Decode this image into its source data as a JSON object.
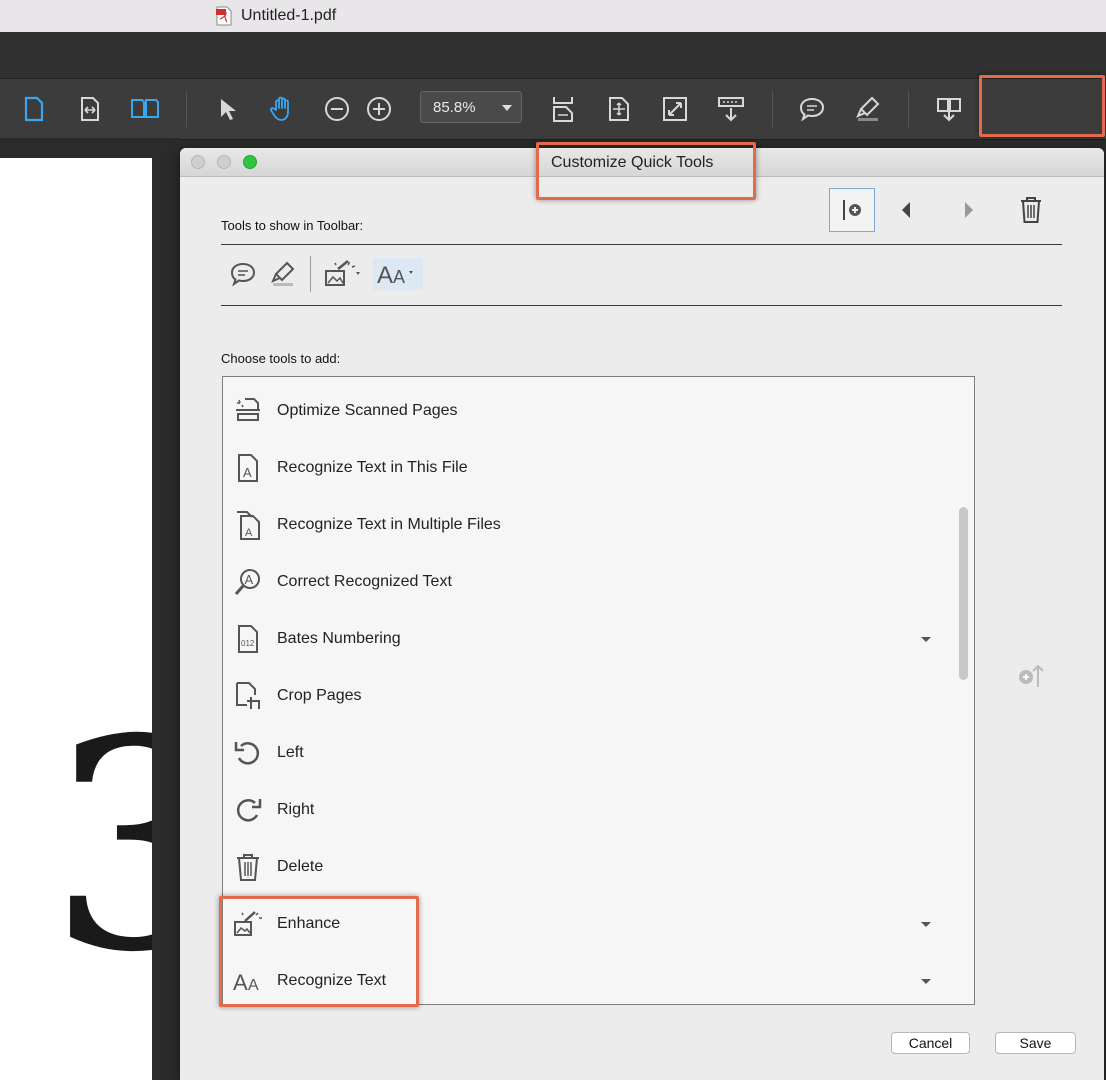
{
  "window": {
    "title": "Untitled-1.pdf"
  },
  "toolbar": {
    "zoom_value": "85.8%",
    "icons": [
      "single-page-icon",
      "fit-width-icon",
      "two-page-icon",
      "select-arrow-icon",
      "hand-icon",
      "zoom-out-icon",
      "zoom-in-icon",
      "scroll-mode-icon",
      "rotate-page-icon",
      "full-screen-icon",
      "read-mode-icon",
      "comment-icon",
      "highlight-icon",
      "share-file-icon"
    ]
  },
  "page": {
    "digit": "3"
  },
  "dialog": {
    "title": "Customize Quick Tools",
    "toolbar_label": "Tools to show in Toolbar:",
    "toolbar_tools": [
      "comment-icon",
      "highlight-icon",
      "enhance-icon",
      "recognize-text-icon"
    ],
    "choose_label": "Choose tools to add:",
    "tools": [
      {
        "label": "Optimize Scanned Pages",
        "icon": "optimize-scan-icon",
        "dropdown": false
      },
      {
        "label": "Recognize Text in This File",
        "icon": "recognize-file-icon",
        "dropdown": false
      },
      {
        "label": "Recognize Text in Multiple Files",
        "icon": "recognize-multi-icon",
        "dropdown": false
      },
      {
        "label": "Correct Recognized Text",
        "icon": "correct-text-icon",
        "dropdown": false
      },
      {
        "label": "Bates Numbering",
        "icon": "bates-icon",
        "dropdown": true
      },
      {
        "label": "Crop Pages",
        "icon": "crop-icon",
        "dropdown": false
      },
      {
        "label": "Left",
        "icon": "rotate-left-icon",
        "dropdown": false
      },
      {
        "label": "Right",
        "icon": "rotate-right-icon",
        "dropdown": false
      },
      {
        "label": "Delete",
        "icon": "trash-icon",
        "dropdown": false
      },
      {
        "label": "Enhance",
        "icon": "enhance-icon",
        "dropdown": true
      },
      {
        "label": "Recognize Text",
        "icon": "recognize-text-icon",
        "dropdown": true
      }
    ],
    "bates_icon_text": "012",
    "cancel_label": "Cancel",
    "save_label": "Save"
  },
  "colors": {
    "accent": "#3ba6f0",
    "highlight": "#e46a4c",
    "toolbar_bg": "#3c3c3c",
    "dialog_bg": "#ececec"
  }
}
